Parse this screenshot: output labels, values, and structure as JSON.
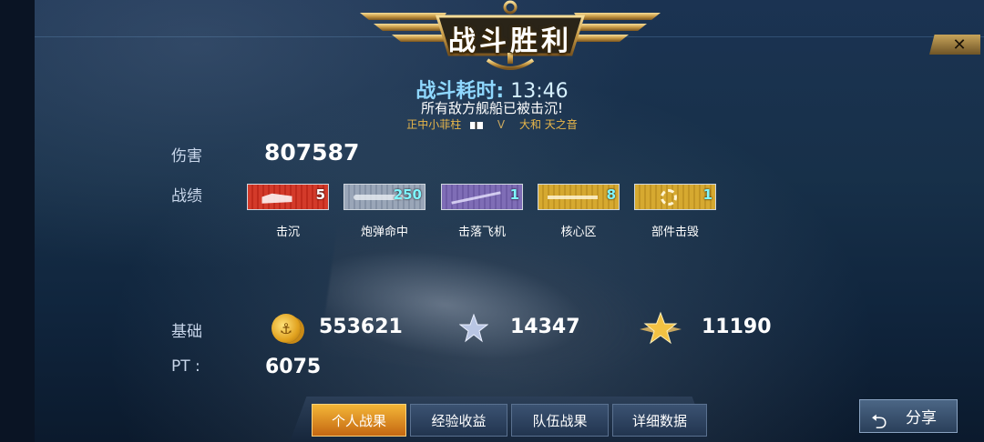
{
  "header": {
    "title": "战斗胜利"
  },
  "battle": {
    "duration_label": "战斗耗时:",
    "duration_value": "13:46",
    "result_text": "所有敌方舰船已被击沉!",
    "player_name": "正中小菲柱",
    "vs_text": "V",
    "opponent_name": "大和 天之音"
  },
  "stats": {
    "damage_label": "伤害",
    "damage_value": "807587",
    "record_label": "战绩",
    "medals": [
      {
        "icon": "sink-medal-icon",
        "count": "5",
        "label": "击沉",
        "color": "#d33a2a"
      },
      {
        "icon": "shell-hit-medal-icon",
        "count": "250",
        "label": "炮弹命中",
        "color": "#9aa6b8"
      },
      {
        "icon": "aircraft-down-medal-icon",
        "count": "1",
        "label": "击落飞机",
        "color": "#7f6db6"
      },
      {
        "icon": "citadel-medal-icon",
        "count": "8",
        "label": "核心区",
        "color": "#d6a930"
      },
      {
        "icon": "module-destroyed-medal-icon",
        "count": "1",
        "label": "部件击毁",
        "color": "#d6a930"
      }
    ],
    "base_label": "基础",
    "coins": "553621",
    "xp": "14347",
    "elite_xp": "11190",
    "pt_label": "PT :",
    "pt_value": "6075"
  },
  "tabs": [
    {
      "label": "个人战果",
      "active": true
    },
    {
      "label": "经验收益",
      "active": false
    },
    {
      "label": "队伍战果",
      "active": false
    },
    {
      "label": "详细数据",
      "active": false
    }
  ],
  "share_label": "分享",
  "close_icon": "close-icon",
  "colors": {
    "accent_gold": "#d6a930",
    "title_cyan": "#8fd8ff"
  }
}
